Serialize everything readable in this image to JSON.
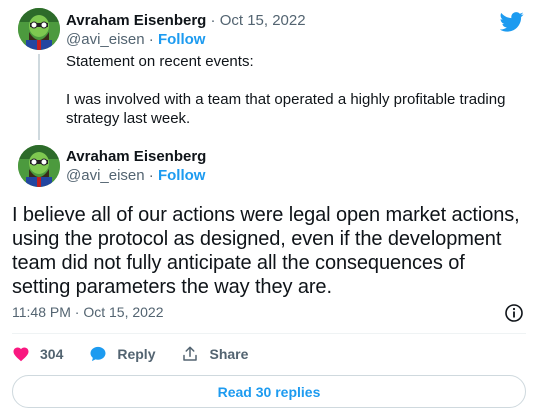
{
  "tweet1": {
    "display_name": "Avraham Eisenberg",
    "separator": " · ",
    "date": "Oct 15, 2022",
    "handle": "@avi_eisen",
    "follow_label": "Follow",
    "paragraphs": [
      "Statement on recent events:",
      "I was involved with a team that operated a highly profitable trading strategy last week."
    ]
  },
  "tweet2": {
    "display_name": "Avraham Eisenberg",
    "handle": "@avi_eisen",
    "follow_label": "Follow",
    "text": "I believe all of our actions were legal open market actions, using the protocol as designed, even if the development team did not fully anticipate all the consequences of setting parameters the way they are.",
    "timestamp": "11:48 PM · Oct 15, 2022"
  },
  "actions": {
    "like_count": "304",
    "reply_label": "Reply",
    "share_label": "Share"
  },
  "read_replies_label": "Read 30 replies",
  "icons": {
    "brand": "twitter-bird-icon",
    "like": "heart-icon",
    "reply": "speech-bubble-icon",
    "share": "share-upload-icon",
    "info": "info-icon"
  },
  "colors": {
    "accent": "#1d9bf0",
    "like": "#f91880",
    "text": "#0f1419",
    "muted": "#536471"
  }
}
